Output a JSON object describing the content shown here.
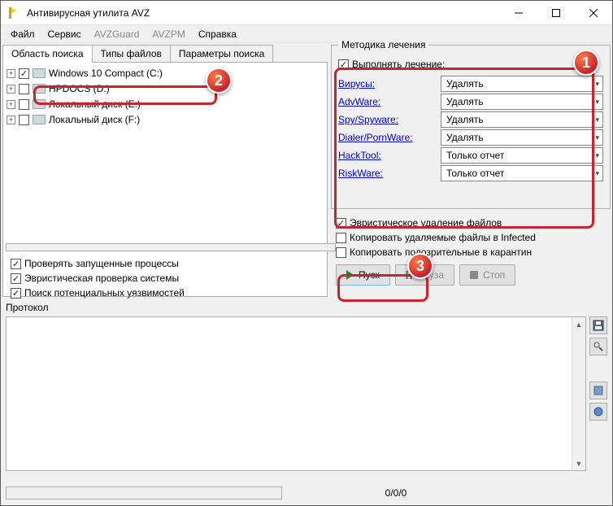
{
  "title": "Антивирусная утилита AVZ",
  "menu": [
    "Файл",
    "Сервис",
    "AVZGuard",
    "AVZPM",
    "Справка"
  ],
  "menu_disabled": [
    false,
    false,
    true,
    true,
    false
  ],
  "tabs": [
    "Область поиска",
    "Типы файлов",
    "Параметры поиска"
  ],
  "drives": [
    {
      "label": "Windows 10 Compact (C:)",
      "checked": true
    },
    {
      "label": "HPDOCS (D:)",
      "checked": false
    },
    {
      "label": "Локальный диск (E:)",
      "checked": false
    },
    {
      "label": "Локальный диск (F:)",
      "checked": false
    }
  ],
  "method_legend": "Методика лечения",
  "perform_treatment": {
    "label": "Выполнять лечение:",
    "checked": true
  },
  "methods": [
    {
      "name": "Вирусы:",
      "value": "Удалять"
    },
    {
      "name": "AdvWare:",
      "value": "Удалять"
    },
    {
      "name": "Spy/Spyware:",
      "value": "Удалять"
    },
    {
      "name": "Dialer/PornWare:",
      "value": "Удалять"
    },
    {
      "name": "HackTool:",
      "value": "Только отчет"
    },
    {
      "name": "RiskWare:",
      "value": "Только отчет"
    }
  ],
  "right_checks": [
    {
      "label": "Эвристическое удаление файлов",
      "checked": true
    },
    {
      "label": "Копировать удаляемые файлы в Infected",
      "checked": false
    },
    {
      "label": "Копировать подозрительные в карантин",
      "checked": false
    }
  ],
  "left_checks": [
    {
      "label": "Проверять запущенные процессы",
      "checked": true
    },
    {
      "label": "Эвристическая проверка системы",
      "checked": true
    },
    {
      "label": "Поиск потенциальных уязвимостей",
      "checked": true
    }
  ],
  "buttons": {
    "start": "Пуск",
    "pause": "Пауза",
    "stop": "Стоп"
  },
  "protocol_label": "Протокол",
  "progress_text": "0/0/0"
}
